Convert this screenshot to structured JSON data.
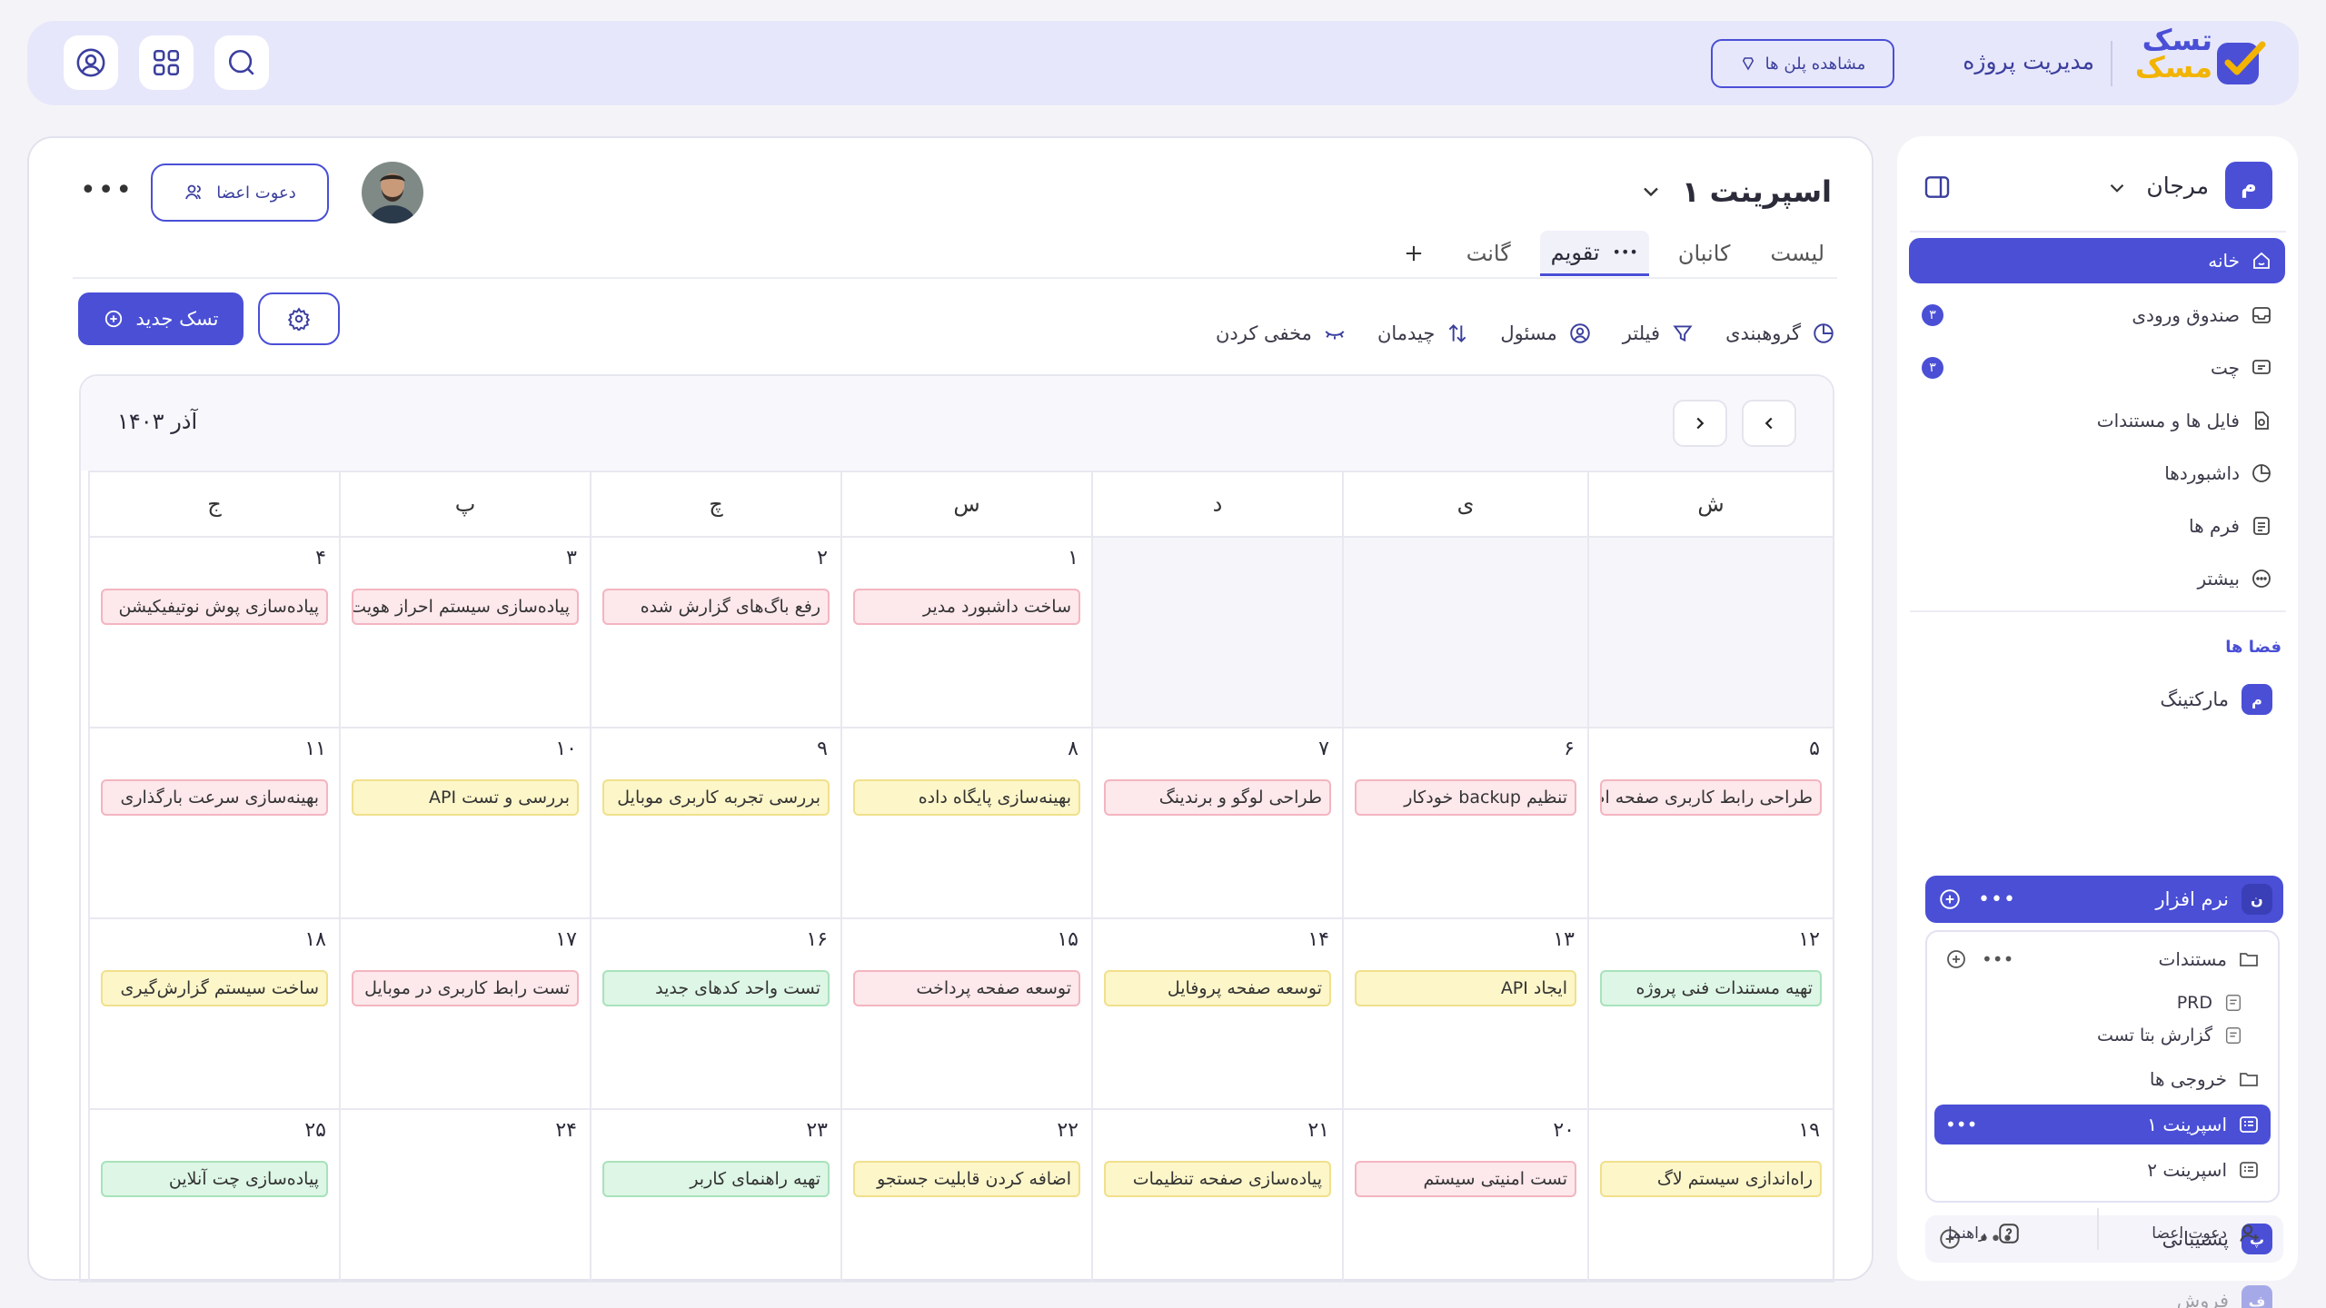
{
  "topbar": {
    "logo_line1": "تسک",
    "logo_line2": "مسک",
    "app_title": "مدیریت پروژه",
    "plans_button": "مشاهده پلن ها"
  },
  "sidebar": {
    "workspace_name": "مرجان",
    "workspace_initial": "م",
    "nav": [
      {
        "label": "خانه",
        "icon": "home-icon"
      },
      {
        "label": "صندوق ورودی",
        "icon": "inbox-icon",
        "badge": "۳"
      },
      {
        "label": "چت",
        "icon": "chat-icon",
        "badge": "۳"
      },
      {
        "label": "فایل ها و مستندات",
        "icon": "file-icon"
      },
      {
        "label": "داشبوردها",
        "icon": "dashboard-icon"
      },
      {
        "label": "فرم ها",
        "icon": "form-icon"
      },
      {
        "label": "بیشتر",
        "icon": "more-icon"
      }
    ],
    "spaces_label": "فضا ها",
    "spaces": [
      {
        "label": "مارکتینگ",
        "initial": "م"
      },
      {
        "label": "نرم افزار",
        "initial": "ن"
      },
      {
        "label": "پشتیبانی",
        "initial": "پ"
      },
      {
        "label": "فروش",
        "initial": "ف"
      }
    ],
    "tree": [
      {
        "label": "مستندات"
      },
      {
        "label": "PRD"
      },
      {
        "label": "گزارش بتا تست"
      },
      {
        "label": "خروجی ها"
      },
      {
        "label": "اسپرینت ۱"
      },
      {
        "label": "اسپرینت ۲"
      }
    ],
    "invite_label": "دعوت اعضا",
    "help_label": "راهنما"
  },
  "main": {
    "title": "اسپرینت ۱",
    "invite_button": "دعوت اعضا",
    "tabs": [
      "لیست",
      "کانبان",
      "تقویم",
      "گانت"
    ],
    "tools": [
      "گروهبندی",
      "فیلتر",
      "مسئول",
      "چیدمان",
      "مخفی کردن"
    ],
    "new_task_button": "تسک جدید"
  },
  "calendar": {
    "month": "آذر ۱۴۰۳",
    "weekdays": [
      "ش",
      "ی",
      "د",
      "س",
      "چ",
      "پ",
      "ج"
    ],
    "weeks": [
      [
        null,
        null,
        null,
        {
          "day": "۱",
          "task": "ساخت داشبورد مدیر",
          "color": "red"
        },
        {
          "day": "۲",
          "task": "رفع باگ‌های گزارش شده",
          "color": "red"
        },
        {
          "day": "۳",
          "task": "پیاده‌سازی سیستم احراز هویت",
          "color": "red"
        },
        {
          "day": "۴",
          "task": "پیاده‌سازی پوش نوتیفیکیشن",
          "color": "red"
        }
      ],
      [
        {
          "day": "۵",
          "task": "طراحی رابط کاربری صفحه اصلی",
          "color": "red"
        },
        {
          "day": "۶",
          "task": "تنظیم backup خودکار",
          "color": "red"
        },
        {
          "day": "۷",
          "task": "طراحی لوگو و برندینگ",
          "color": "red"
        },
        {
          "day": "۸",
          "task": "بهینه‌سازی پایگاه داده",
          "color": "yellow"
        },
        {
          "day": "۹",
          "task": "بررسی تجربه کاربری موبایل",
          "color": "yellow"
        },
        {
          "day": "۱۰",
          "task": "بررسی و تست API",
          "color": "yellow"
        },
        {
          "day": "۱۱",
          "task": "بهینه‌سازی سرعت بارگذاری",
          "color": "red"
        }
      ],
      [
        {
          "day": "۱۲",
          "task": "تهیه مستندات فنی پروژه",
          "color": "green"
        },
        {
          "day": "۱۳",
          "task": "ایجاد API",
          "color": "yellow"
        },
        {
          "day": "۱۴",
          "task": "توسعه صفحه پروفایل",
          "color": "yellow"
        },
        {
          "day": "۱۵",
          "task": "توسعه صفحه پرداخت",
          "color": "red"
        },
        {
          "day": "۱۶",
          "task": "تست واحد کدهای جدید",
          "color": "green"
        },
        {
          "day": "۱۷",
          "task": "تست رابط کاربری در موبایل",
          "color": "red"
        },
        {
          "day": "۱۸",
          "task": "ساخت سیستم گزارش‌گیری",
          "color": "yellow"
        }
      ],
      [
        {
          "day": "۱۹",
          "task": "راه‌اندازی سیستم لاگ",
          "color": "yellow"
        },
        {
          "day": "۲۰",
          "task": "تست امنیتی سیستم",
          "color": "red"
        },
        {
          "day": "۲۱",
          "task": "پیاده‌سازی صفحه تنظیمات",
          "color": "yellow"
        },
        {
          "day": "۲۲",
          "task": "اضافه کردن قابلیت جستجو",
          "color": "yellow"
        },
        {
          "day": "۲۳",
          "task": "تهیه راهنمای کاربر",
          "color": "green"
        },
        {
          "day": "۲۴",
          "task": "",
          "color": ""
        },
        {
          "day": "۲۵",
          "task": "پیاده‌سازی چت آنلاین",
          "color": "green"
        }
      ]
    ]
  },
  "colors": {
    "accent": "#4a4fd6",
    "brand_yellow": "#f2b400"
  }
}
